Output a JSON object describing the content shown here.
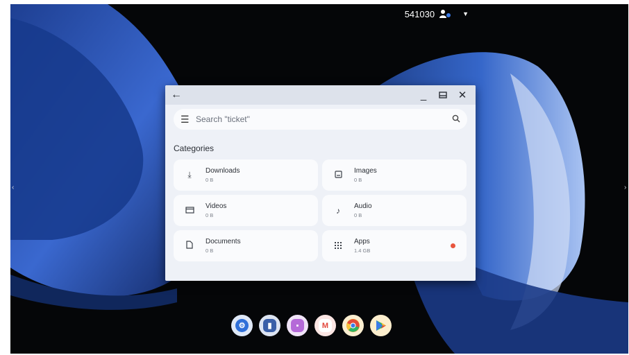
{
  "status": {
    "clock": "541030"
  },
  "window": {
    "back_icon": "back-arrow-icon",
    "search": {
      "placeholder": "Search \"ticket\""
    },
    "section_title": "Categories",
    "categories": [
      {
        "label": "Downloads",
        "size": "0 B",
        "icon": "download-icon"
      },
      {
        "label": "Images",
        "size": "0 B",
        "icon": "image-icon"
      },
      {
        "label": "Videos",
        "size": "0 B",
        "icon": "video-icon"
      },
      {
        "label": "Audio",
        "size": "0 B",
        "icon": "music-note-icon"
      },
      {
        "label": "Documents",
        "size": "0 B",
        "icon": "document-icon"
      },
      {
        "label": "Apps",
        "size": "1.4 GB",
        "icon": "apps-grid-icon"
      }
    ]
  },
  "dock": [
    {
      "name": "settings",
      "icon": "settings-app-icon",
      "color": "#2f6fd8"
    },
    {
      "name": "files",
      "icon": "files-app-icon",
      "color": "#3a5fa8"
    },
    {
      "name": "gallery",
      "icon": "gallery-app-icon",
      "color": "#b56ad8"
    },
    {
      "name": "gmail",
      "icon": "gmail-app-icon",
      "color": "#e2473c"
    },
    {
      "name": "chrome",
      "icon": "chrome-app-icon",
      "color": "#e9a521"
    },
    {
      "name": "play-store",
      "icon": "play-store-app-icon",
      "color": "#2db463"
    }
  ],
  "colors": {
    "accent_dot": "#e8553e",
    "wallpaper_blue": "#2a55b8"
  }
}
